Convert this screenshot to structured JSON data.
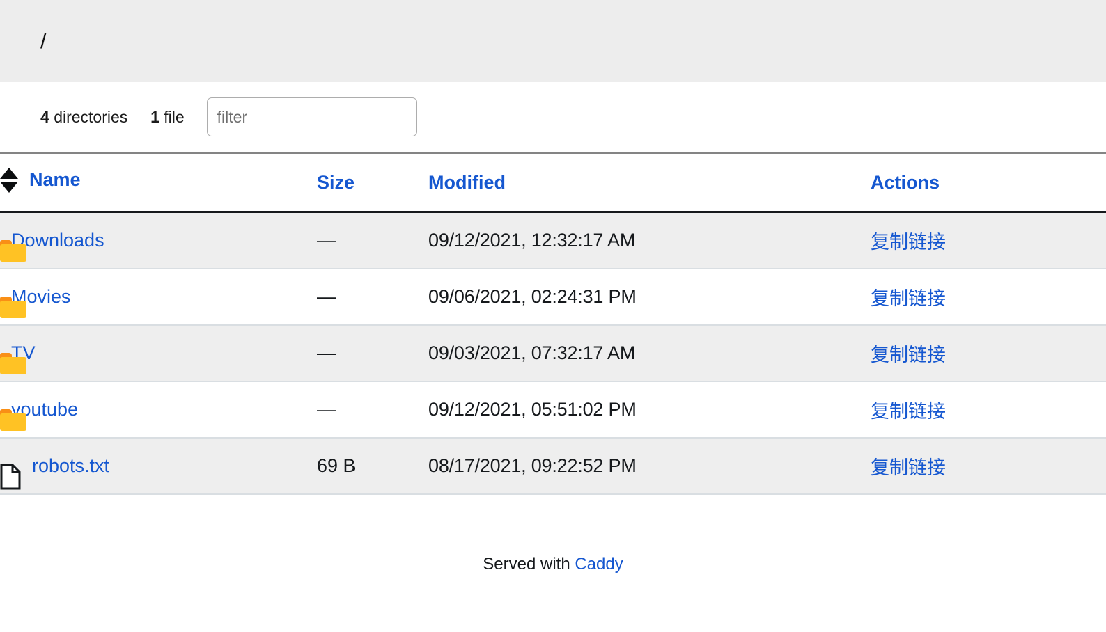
{
  "page": {
    "breadcrumb": "/",
    "colors": {
      "link_blue": "#1557d0",
      "folder_body": "#ffc224",
      "folder_tab": "#f98f16",
      "header_band": "#ededed",
      "row_shaded": "#eeeeee",
      "row_divider": "#d9dee2",
      "header_rule_top": "#848484",
      "header_rule_bottom": "#16191c"
    }
  },
  "summary": {
    "directories_count": "4",
    "directories_label": "directories",
    "files_count": "1",
    "files_label": "file"
  },
  "filter": {
    "value": "",
    "placeholder": "filter"
  },
  "table": {
    "columns": {
      "name": "Name",
      "size": "Size",
      "modified": "Modified",
      "actions": "Actions"
    },
    "sort_icon": "sort-updown-icon",
    "rows": [
      {
        "icon": "folder-icon",
        "type": "directory",
        "name": "Downloads",
        "size": "—",
        "modified": "09/12/2021, 12:32:17 AM",
        "action": "复制链接",
        "shaded": true
      },
      {
        "icon": "folder-icon",
        "type": "directory",
        "name": "Movies",
        "size": "—",
        "modified": "09/06/2021, 02:24:31 PM",
        "action": "复制链接",
        "shaded": false
      },
      {
        "icon": "folder-icon",
        "type": "directory",
        "name": "TV",
        "size": "—",
        "modified": "09/03/2021, 07:32:17 AM",
        "action": "复制链接",
        "shaded": true
      },
      {
        "icon": "folder-icon",
        "type": "directory",
        "name": "youtube",
        "size": "—",
        "modified": "09/12/2021, 05:51:02 PM",
        "action": "复制链接",
        "shaded": false
      },
      {
        "icon": "file-icon",
        "type": "file",
        "name": "robots.txt",
        "size": "69 B",
        "modified": "08/17/2021, 09:22:52 PM",
        "action": "复制链接",
        "shaded": true
      }
    ]
  },
  "footer": {
    "text": "Served with",
    "link_label": "Caddy"
  }
}
